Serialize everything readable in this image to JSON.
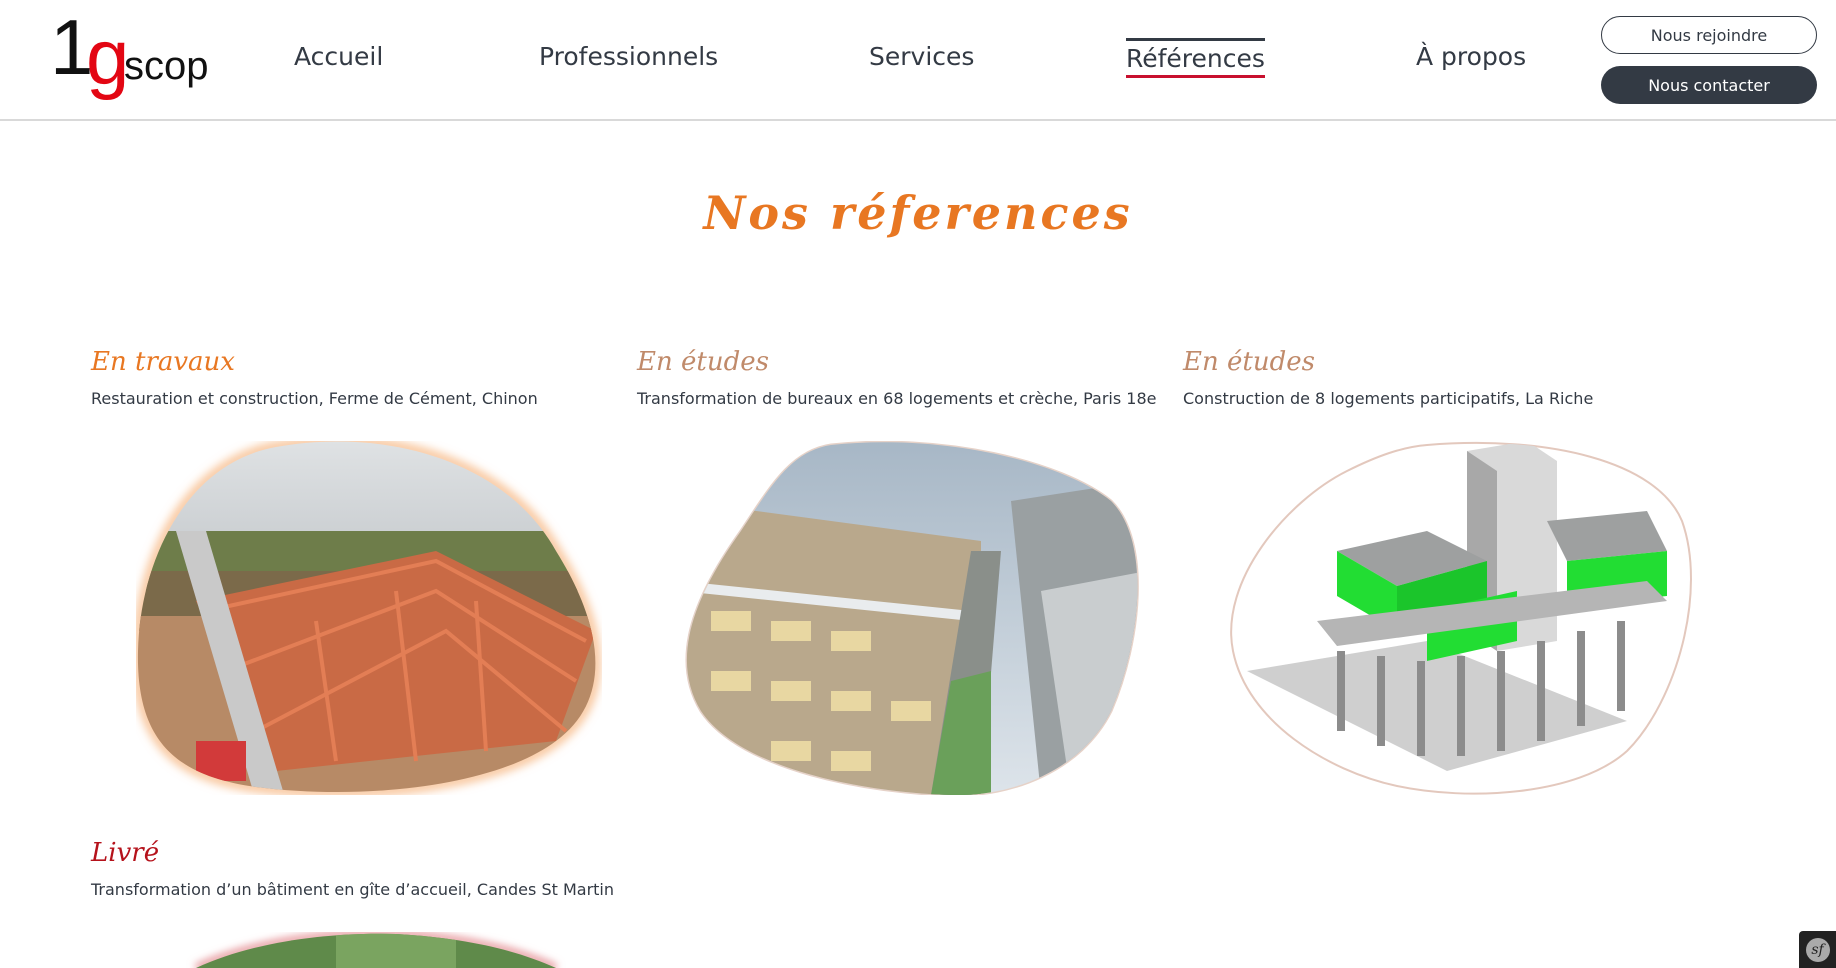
{
  "header": {
    "logo": {
      "one": "1",
      "g": "g",
      "scop": "scop"
    },
    "nav": [
      {
        "label": "Accueil"
      },
      {
        "label": "Professionnels"
      },
      {
        "label": "Services"
      },
      {
        "label": "Références",
        "active": true
      },
      {
        "label": "À propos"
      }
    ],
    "join_label": "Nous rejoindre",
    "contact_label": "Nous contacter"
  },
  "main": {
    "title": "Nos réferences",
    "cards": [
      {
        "status": "En travaux",
        "description": "Restauration et construction, Ferme de Cément, Chinon"
      },
      {
        "status": "En études",
        "description": "Transformation de bureaux en 68 logements et crèche, Paris 18e"
      },
      {
        "status": "En études",
        "description": "Construction de 8 logements participatifs, La Riche"
      },
      {
        "status": "Livré",
        "description": "Transformation d’un bâtiment en gîte d’accueil, Candes St Martin"
      }
    ]
  },
  "colors": {
    "accent_orange": "#e87722",
    "accent_tan": "#c08a6a",
    "accent_red": "#b5121b",
    "dark": "#333a44",
    "logo_red": "#e30613"
  },
  "icons": {
    "debug_toolbar": "symfony-icon",
    "debug_toolbar_glyph": "sf"
  }
}
